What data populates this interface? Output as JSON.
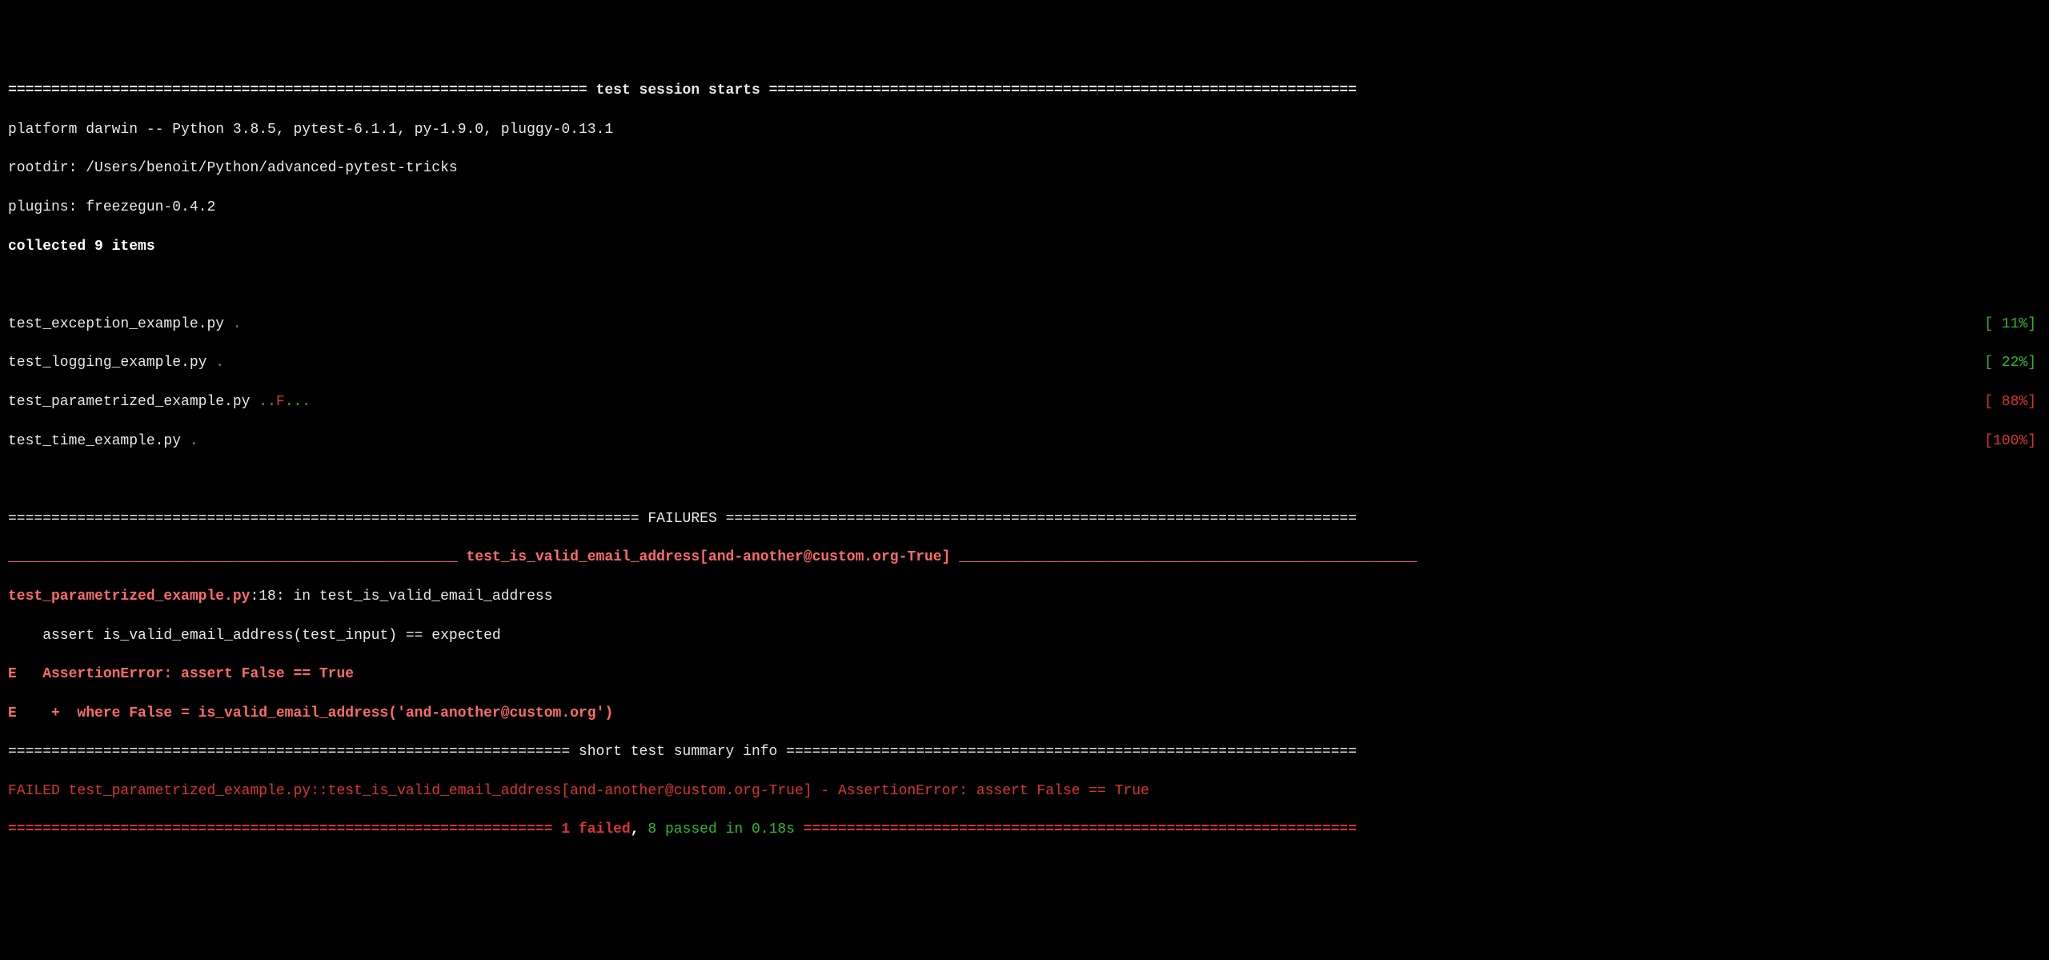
{
  "header": {
    "title": "test session starts",
    "platform": "platform darwin -- Python 3.8.5, pytest-6.1.1, py-1.9.0, pluggy-0.13.1",
    "rootdir": "rootdir: /Users/benoit/Python/advanced-pytest-tricks",
    "plugins": "plugins: freezegun-0.4.2",
    "collected": "collected 9 items"
  },
  "tests": [
    {
      "name": "test_exception_example.py ",
      "marks": ".",
      "pct": "[ 11%]",
      "pct_color": "green"
    },
    {
      "name": "test_logging_example.py ",
      "marks": ".",
      "pct": "[ 22%]",
      "pct_color": "green"
    },
    {
      "name": "test_parametrized_example.py ",
      "marks_pre": "..",
      "marks_fail": "F",
      "marks_post": "...",
      "pct": "[ 88%]",
      "pct_color": "red"
    },
    {
      "name": "test_time_example.py ",
      "marks": ".",
      "pct": "[100%]",
      "pct_color": "red"
    }
  ],
  "failures": {
    "section_title": "FAILURES",
    "test_title": "test_is_valid_email_address[and-another@custom.org-True]",
    "trace_file": "test_parametrized_example.py",
    "trace_loc": ":18: in test_is_valid_email_address",
    "trace_assert": "    assert is_valid_email_address(test_input) == expected",
    "err_line1": "E   AssertionError: assert False == True",
    "err_line2": "E    +  where False = is_valid_email_address('and-another@custom.org')"
  },
  "summary": {
    "section_title": "short test summary info",
    "failed_line_pre": "FAILED test_parametrized_example.py::test_is_valid_email_address[and-another@custom.org-True] - AssertionError: assert False == True",
    "final_failed": "1 failed",
    "final_sep1": ", ",
    "final_passed": "8 passed",
    "final_in": " in 0.18s"
  }
}
